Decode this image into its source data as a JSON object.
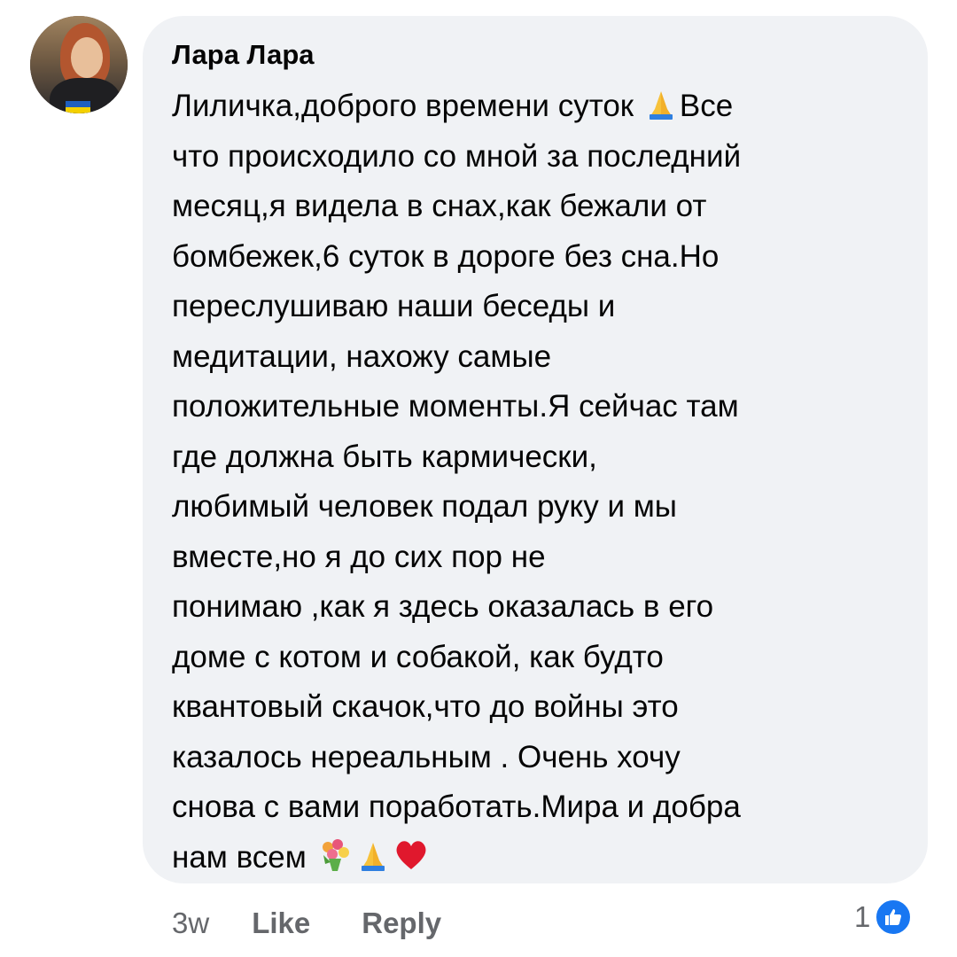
{
  "comment": {
    "author": "Лара Лара",
    "text_lines": [
      "Лиличка,доброго времени суток",
      "Все",
      "что происходило со мной за последний",
      "месяц,я видела в снах,как бежали от",
      "бомбежек,6 суток в дороге без сна.Но",
      "переслушиваю наши беседы и",
      "медитации, нахожу самые",
      "положительные моменты.Я сейчас там",
      "где должна быть кармически,",
      "любимый человек подал руку и мы",
      "вместе,но я до сих пор не",
      "понимаю ,как я здесь оказалась в его",
      "доме с котом и собакой, как будто",
      "квантовый скачок,что до войны это",
      "казалось нереальным . Очень хочу",
      "снова с вами поработать.Мира и добра",
      "нам всем"
    ],
    "emojis": [
      "folded-hands",
      "bouquet",
      "folded-hands",
      "red-heart"
    ],
    "timestamp": "3w",
    "like_label": "Like",
    "reply_label": "Reply",
    "reaction_count": "1",
    "reaction_icon": "thumbs-up"
  },
  "colors": {
    "bubble_bg": "#f0f2f5",
    "text": "#050505",
    "meta_text": "#65676b",
    "like_blue": "#1877f2"
  }
}
